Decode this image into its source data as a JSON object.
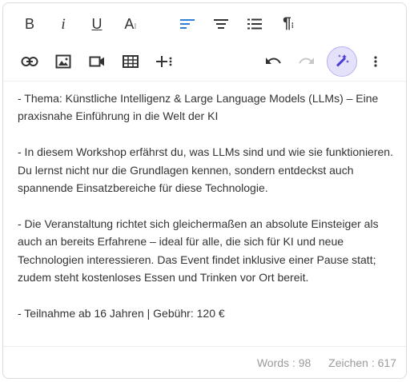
{
  "toolbar": {
    "row1": [
      {
        "name": "bold-button",
        "icon": "bold-icon",
        "glyph": "B"
      },
      {
        "name": "italic-button",
        "icon": "italic-icon",
        "glyph": "i"
      },
      {
        "name": "underline-button",
        "icon": "underline-icon",
        "glyph": "U"
      },
      {
        "name": "font-size-button",
        "icon": "font-size-icon",
        "glyph": "A"
      },
      {
        "name": "align-button",
        "icon": "align-left-icon",
        "active": true
      },
      {
        "name": "align-center-button",
        "icon": "align-center-icon"
      },
      {
        "name": "list-button",
        "icon": "ordered-list-icon"
      },
      {
        "name": "paragraph-button",
        "icon": "paragraph-icon"
      }
    ],
    "row2": [
      {
        "name": "link-button",
        "icon": "link-icon"
      },
      {
        "name": "image-button",
        "icon": "image-icon"
      },
      {
        "name": "video-button",
        "icon": "video-icon"
      },
      {
        "name": "table-button",
        "icon": "table-icon"
      },
      {
        "name": "insert-more-button",
        "icon": "plus-more-icon"
      },
      {
        "name": "undo-button",
        "icon": "undo-icon"
      },
      {
        "name": "redo-button",
        "icon": "redo-icon",
        "disabled": true
      },
      {
        "name": "ai-magic-button",
        "icon": "magic-wand-icon",
        "highlight": true
      },
      {
        "name": "more-options-button",
        "icon": "more-vertical-icon"
      }
    ]
  },
  "colors": {
    "accent": "#2f7fd8",
    "magic_bg": "#e4e1fb",
    "magic_border": "#b7b0ee",
    "magic_icon": "#4b3fd1",
    "text": "#333333",
    "muted": "#9a9a9a"
  },
  "content": {
    "paragraphs": [
      "- Thema: Künstliche Intelligenz & Large Language Models (LLMs) – Eine praxisnahe Einführung in die Welt der KI",
      "- In diesem Workshop erfährst du, was LLMs sind und wie sie funktionieren. Du lernst nicht nur die Grundlagen kennen, sondern entdeckst auch spannende Einsatzbereiche für diese Technologie.",
      "- Die Veranstaltung richtet sich gleichermaßen an absolute Einsteiger als auch an bereits Erfahrene – ideal für alle, die sich für KI und neue Technologien interessieren. Das Event findet inklusive einer Pause statt; zudem steht kostenloses Essen und Trinken vor Ort bereit.",
      "- Teilnahme ab 16 Jahren | Gebühr: 120 €"
    ]
  },
  "footer": {
    "words": "Words : 98",
    "chars": "Zeichen : 617"
  }
}
